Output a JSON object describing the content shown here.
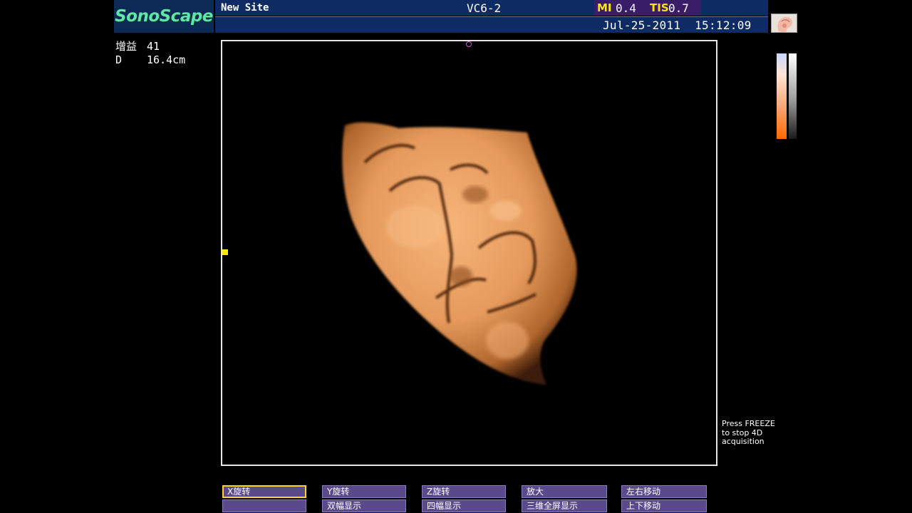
{
  "header": {
    "logo": "SonoScape",
    "site": "New Site",
    "probe": "VC6-2",
    "mi_label": "MI",
    "mi_value": "0.4",
    "tis_label": "TIS",
    "tis_value": "0.7",
    "datetime": "Jul-25-2011  15:12:09"
  },
  "params": {
    "gain_label": "增益",
    "gain_value": "41",
    "depth_label": "D",
    "depth_value": "16.4cm"
  },
  "status_hint": "Press FREEZE\nto stop 4D\nacquisition",
  "softkeys": [
    {
      "label": "X旋转",
      "active": true
    },
    {
      "label": "",
      "active": false
    },
    {
      "label": "Y旋转",
      "active": false
    },
    {
      "label": "双幅显示",
      "active": false
    },
    {
      "label": "Z旋转",
      "active": false
    },
    {
      "label": "四幅显示",
      "active": false
    },
    {
      "label": "放大",
      "active": false
    },
    {
      "label": "三维全屏显示",
      "active": false
    },
    {
      "label": "左右移动",
      "active": false
    },
    {
      "label": "上下移动",
      "active": false
    }
  ],
  "colors": {
    "header_bg": "#0e2c63",
    "logo_text": "#5fe6a8",
    "mi_accent": "#ffe600",
    "softkey_bg": "#5a4a8c",
    "softkey_active_border": "#ffd52a",
    "render_tint": "#f0a060"
  }
}
